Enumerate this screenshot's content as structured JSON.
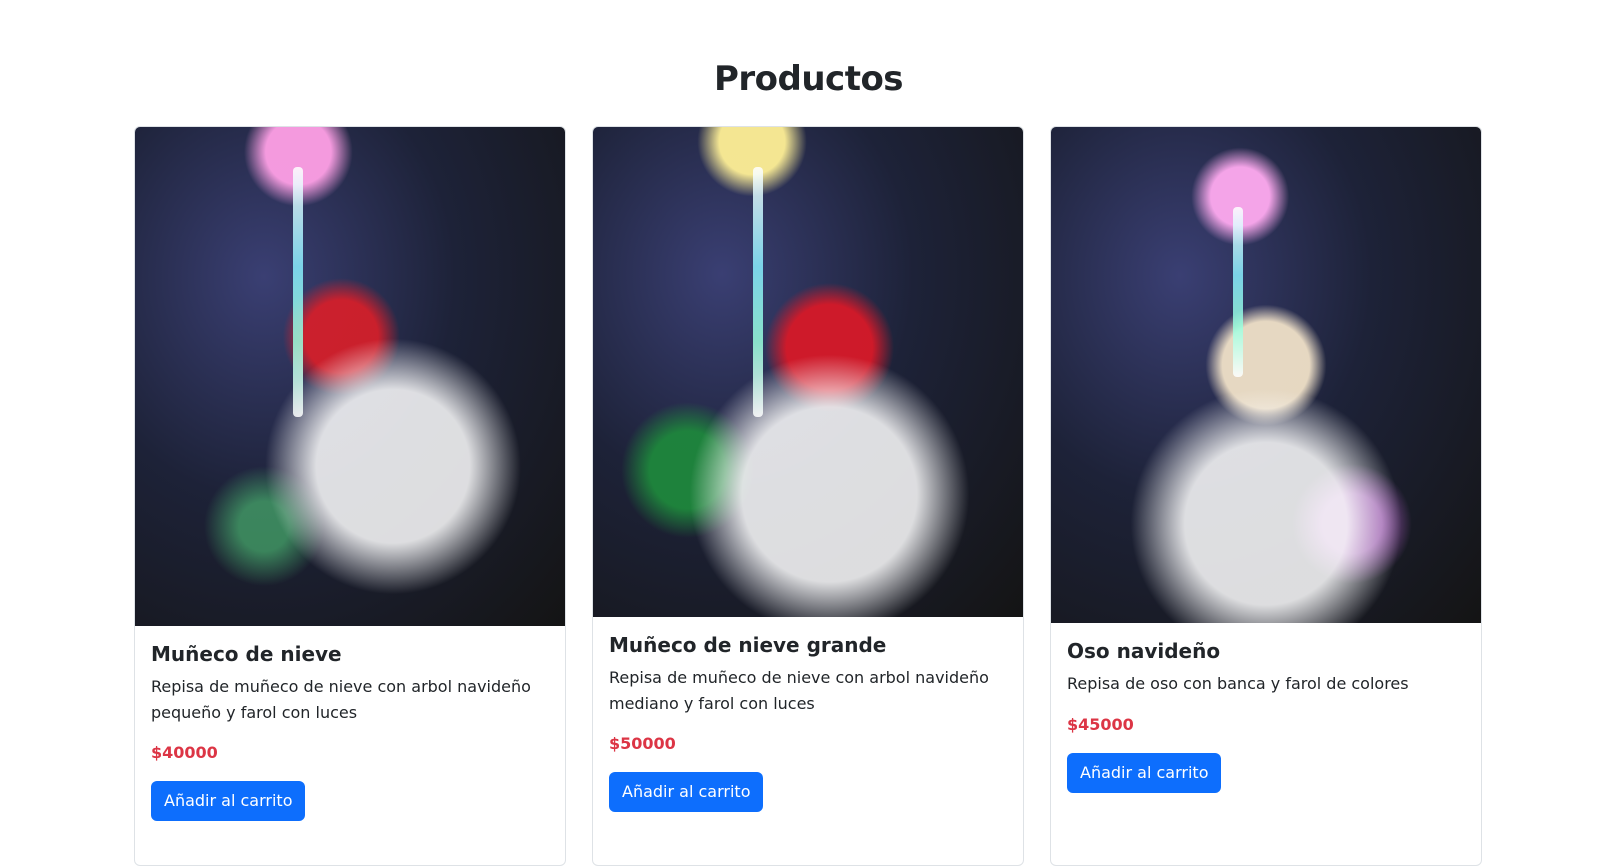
{
  "page": {
    "title": "Productos"
  },
  "products": [
    {
      "name": "Muñeco de nieve",
      "description": "Repisa de muñeco de nieve con arbol navideño pequeño y farol con luces",
      "price": "$40000",
      "button": "Añadir al carrito",
      "image_alt": "Muñeco de nieve"
    },
    {
      "name": "Muñeco de nieve grande",
      "description": "Repisa de muñeco de nieve con arbol navideño mediano y farol con luces",
      "price": "$50000",
      "button": "Añadir al carrito",
      "image_alt": "Muñeco de nieve grande"
    },
    {
      "name": "Oso navideño",
      "description": "Repisa de oso con banca y farol de colores",
      "price": "$45000",
      "button": "Añadir al carrito",
      "image_alt": "Oso navideño"
    }
  ],
  "colors": {
    "price": "#dc3545",
    "button": "#0d6efd"
  }
}
